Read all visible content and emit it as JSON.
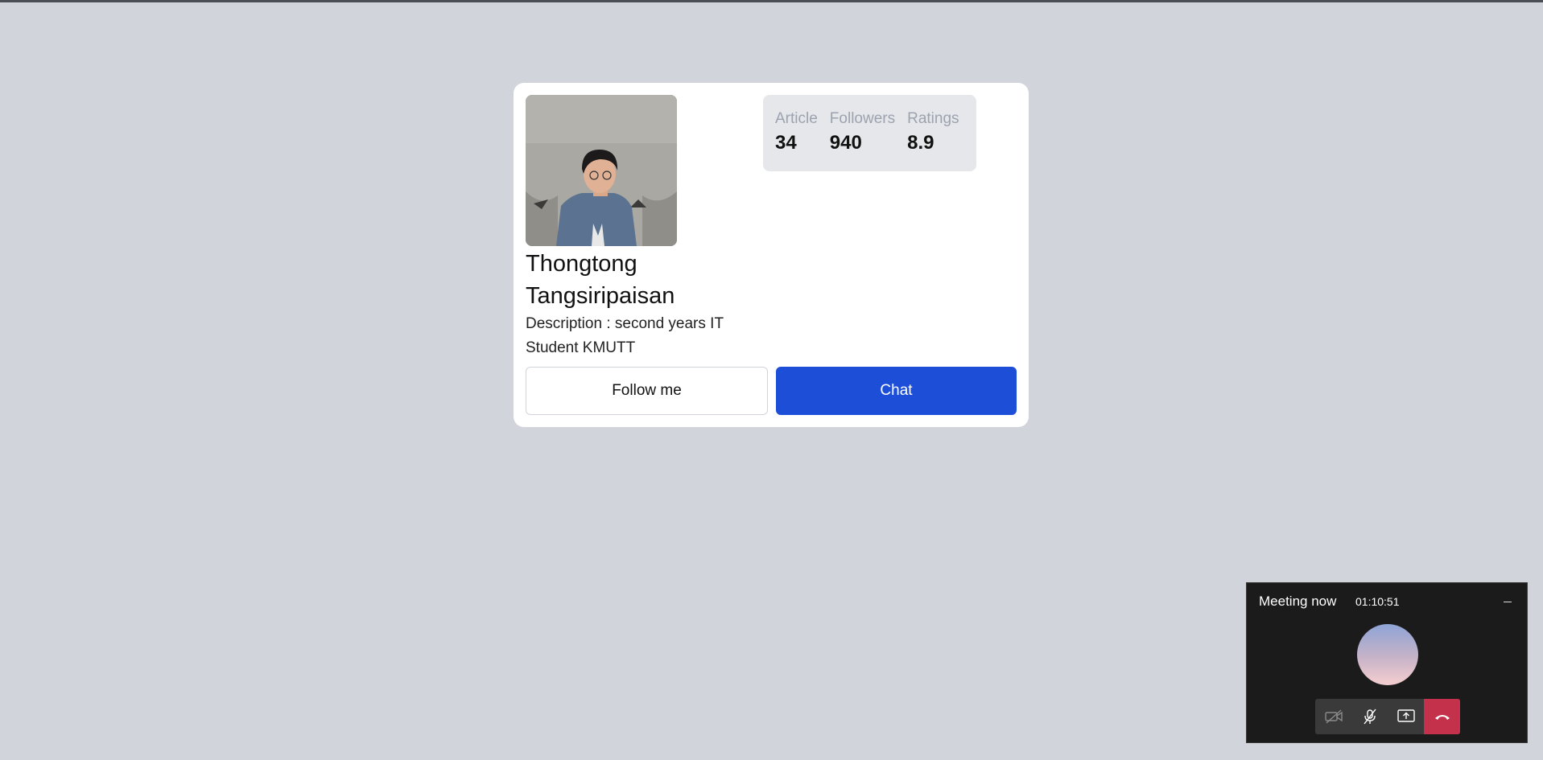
{
  "profile": {
    "name": "Thongtong Tangsiripaisan",
    "description": "Description : second years IT Student KMUTT",
    "stats": [
      {
        "label": "Article",
        "value": "34"
      },
      {
        "label": "Followers",
        "value": "940"
      },
      {
        "label": "Ratings",
        "value": "8.9"
      }
    ],
    "follow_label": "Follow me",
    "chat_label": "Chat"
  },
  "meeting": {
    "title": "Meeting now",
    "time": "01:10:51",
    "controls": [
      "video-off-icon",
      "mic-off-icon",
      "share-screen-icon",
      "hang-up-icon"
    ]
  },
  "colors": {
    "page_bg": "#d1d5db",
    "chat_button": "#1d4ed8",
    "hang_up": "#c4314b"
  }
}
